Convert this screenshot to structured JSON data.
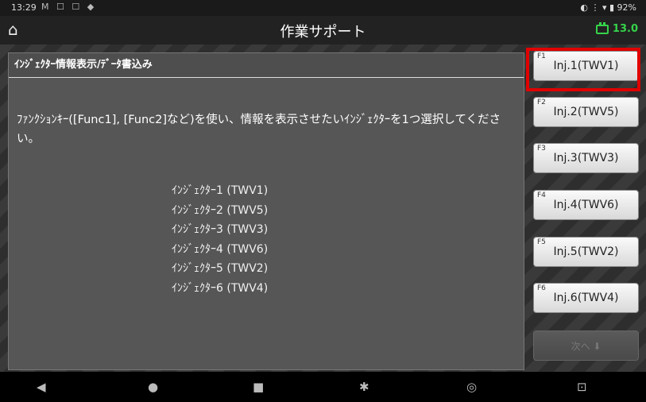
{
  "statusbar": {
    "time": "13:29",
    "notifications": "M ☐ ☐ ◆",
    "right": "◐ ⋮ ▾ ▮ 92%"
  },
  "header": {
    "home_icon": "home-icon",
    "title": "作業サポート",
    "battery_voltage": "13.0"
  },
  "panel": {
    "title": "ｲﾝｼﾞｪｸﾀｰ情報表示/ﾃﾞｰﾀ書込み",
    "instruction": "ﾌｧﾝｸｼｮﾝｷｰ([Func1], [Func2]など)を使い、情報を表示させたいｲﾝｼﾞｪｸﾀｰを1つ選択してください。",
    "injectors": [
      "ｲﾝｼﾞｪｸﾀｰ1 (TWV1)",
      "ｲﾝｼﾞｪｸﾀｰ2 (TWV5)",
      "ｲﾝｼﾞｪｸﾀｰ3 (TWV3)",
      "ｲﾝｼﾞｪｸﾀｰ4 (TWV6)",
      "ｲﾝｼﾞｪｸﾀｰ5 (TWV2)",
      "ｲﾝｼﾞｪｸﾀｰ6 (TWV4)"
    ]
  },
  "fkeys": [
    {
      "num": "F1",
      "label": "Inj.1(TWV1)"
    },
    {
      "num": "F2",
      "label": "Inj.2(TWV5)"
    },
    {
      "num": "F3",
      "label": "Inj.3(TWV3)"
    },
    {
      "num": "F4",
      "label": "Inj.4(TWV6)"
    },
    {
      "num": "F5",
      "label": "Inj.5(TWV2)"
    },
    {
      "num": "F6",
      "label": "Inj.6(TWV4)"
    }
  ],
  "next_button": {
    "label": "次へ ⬇"
  },
  "colors": {
    "accent_highlight": "#e00000",
    "battery": "#35d34a"
  },
  "navbar": {
    "back": "◀",
    "home": "●",
    "recents": "■",
    "settings": "✱",
    "chrome": "◎",
    "screenshot": "⊡"
  }
}
